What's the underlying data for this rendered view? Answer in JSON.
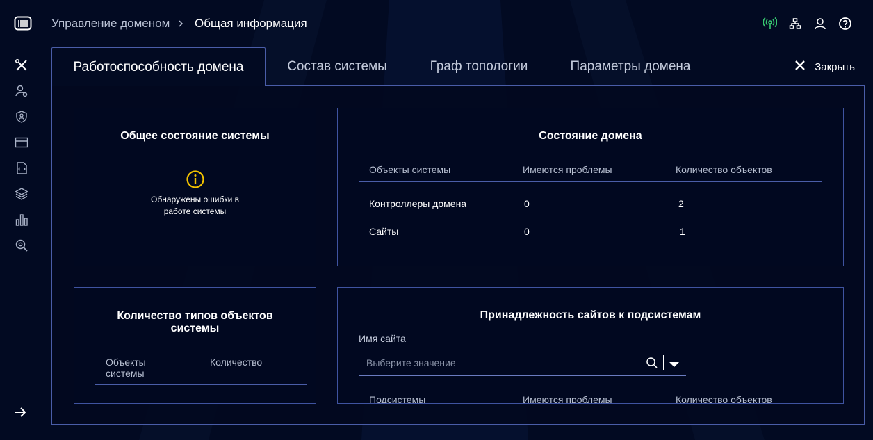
{
  "header": {
    "breadcrumb": [
      "Управление доменом",
      "Общая информация"
    ],
    "icons": [
      "broadcast-icon",
      "network-icon",
      "user-icon",
      "help-icon"
    ]
  },
  "sidebar": {
    "icons": [
      "tools-icon",
      "users-settings-icon",
      "id-badge-icon",
      "card-icon",
      "code-file-icon",
      "layers-icon",
      "bar-chart-icon",
      "search-zoom-icon"
    ],
    "expand_icon": "arrow-right-icon"
  },
  "tabs": [
    "Работоспособность домена",
    "Состав системы",
    "Граф топологии",
    "Параметры домена"
  ],
  "close_label": "Закрыть",
  "overall": {
    "title": "Общее состояние системы",
    "status_line1": "Обнаружены ошибки в",
    "status_line2": "работе системы",
    "warn_color": "#f2c200"
  },
  "domain_state": {
    "title": "Состояние домена",
    "columns": [
      "Объекты системы",
      "Имеются проблемы",
      "Количество объектов"
    ],
    "rows": [
      [
        "Контроллеры домена",
        "0",
        "2"
      ],
      [
        "Сайты",
        "0",
        "1"
      ]
    ]
  },
  "types": {
    "title_line1": "Количество типов объектов",
    "title_line2": "системы",
    "col1_line1": "Объекты",
    "col1_line2": "системы",
    "col2": "Количество"
  },
  "sites": {
    "title": "Принадлежность сайтов к подсистемам",
    "field_label": "Имя сайта",
    "placeholder": "Выберите значение",
    "columns": [
      "Подсистемы",
      "Имеются проблемы",
      "Количество объектов"
    ]
  },
  "colors": {
    "accent": "#4a5da8",
    "ok": "#37c871",
    "bg": "#020a22"
  }
}
